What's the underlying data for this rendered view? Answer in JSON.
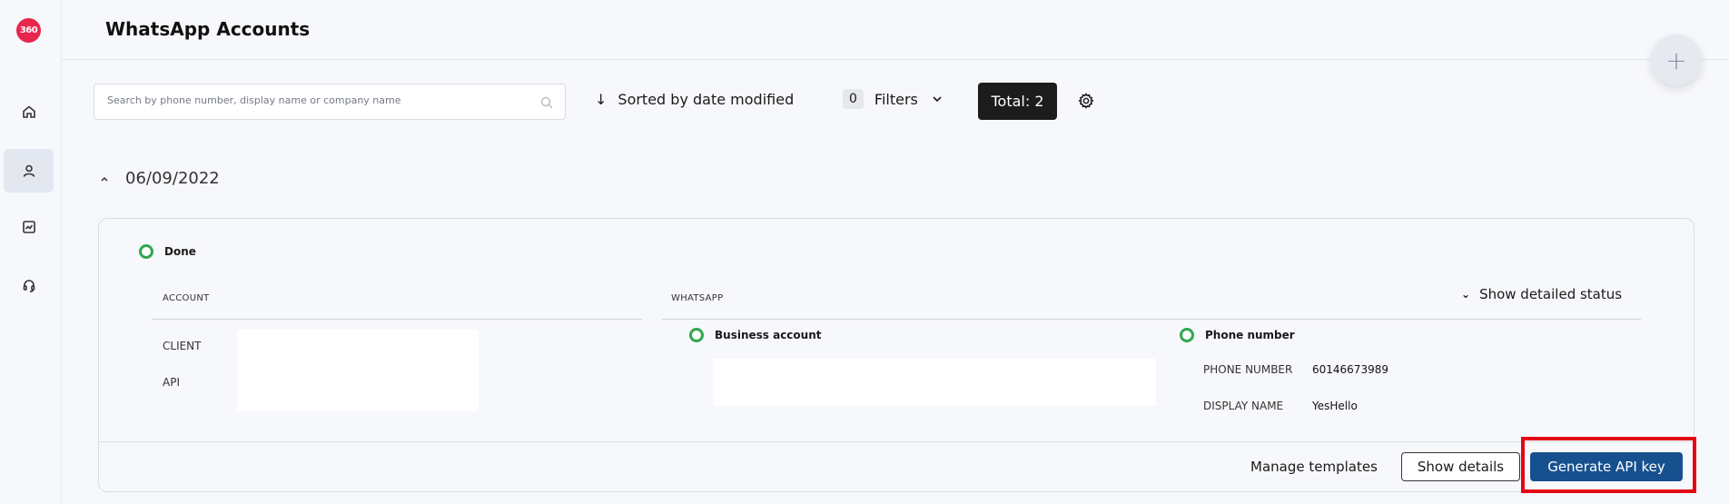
{
  "app": {
    "logo_text": "360",
    "title": "WhatsApp Accounts",
    "add_label": "+"
  },
  "sidebar": {
    "items": [
      {
        "name": "home-icon",
        "active": false
      },
      {
        "name": "user-icon",
        "active": true
      },
      {
        "name": "chart-icon",
        "active": false
      },
      {
        "name": "headset-icon",
        "active": false
      }
    ]
  },
  "toolbar": {
    "search_placeholder": "Search by phone number, display name or company name",
    "sort_label": "Sorted by date modified",
    "filter_count": "0",
    "filters_label": "Filters",
    "total_label": "Total: 2"
  },
  "group": {
    "date": "06/09/2022"
  },
  "card": {
    "status": "Done",
    "status_color": "#2fa84f",
    "account_label": "ACCOUNT",
    "whatsapp_label": "WHATSAPP",
    "show_detailed_status": "Show detailed status",
    "client_label": "CLIENT",
    "api_label": "API",
    "business_account_label": "Business account",
    "phone_number_section": "Phone number",
    "phone_number_key": "PHONE NUMBER",
    "phone_number_value": "60146673989",
    "display_name_key": "DISPLAY NAME",
    "display_name_value": "YesHello",
    "manage_templates": "Manage templates",
    "show_details": "Show details",
    "generate_api_key": "Generate API key"
  },
  "colors": {
    "primary": "#16508f",
    "brand": "#e8264d",
    "highlight": "#e30613"
  }
}
